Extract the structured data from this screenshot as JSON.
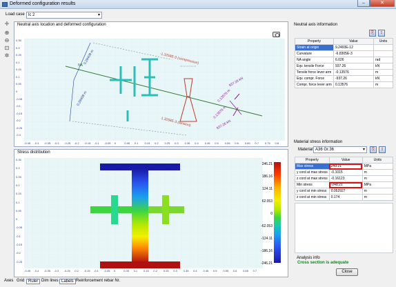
{
  "window": {
    "title": "Deformed configuration results",
    "minimize": "–",
    "close": "✕"
  },
  "load_case": {
    "label": "Load case",
    "value": "lc 2"
  },
  "toolbar": {
    "icons": [
      "pan-icon",
      "zoom-in-icon",
      "zoom-out-icon",
      "zoom-window-icon",
      "zoom-extents-icon"
    ],
    "glyphs": [
      "✛",
      "⊕",
      "⊖",
      "⊡",
      "✲"
    ]
  },
  "neutral_axis_panel": {
    "title": "Neutral axis location and deformed configuration",
    "y_ticks": [
      "0.35",
      "0.3",
      "0.25",
      "0.2",
      "0.15",
      "0.1",
      "0.05",
      "0",
      "-0.05",
      "-0.1",
      "-0.15",
      "-0.2",
      "-0.25",
      "-0.3"
    ],
    "x_ticks": [
      "-0.45",
      "-0.4",
      "-0.35",
      "-0.3",
      "-0.25",
      "-0.2",
      "-0.15",
      "-0.1",
      "-0.05",
      "0",
      "0.05",
      "0.1",
      "0.15",
      "0.2",
      "0.25",
      "0.3",
      "0.35",
      "0.4",
      "0.45",
      "0.5",
      "0.55",
      "0.6",
      "0.65",
      "0.7",
      "0.75",
      "0.8"
    ],
    "annotations": {
      "dim_top": "0.29409 m",
      "dim_bottom": "0.29409 m",
      "na": "NA",
      "strain_comp": "-1.3258E-3 (compression)",
      "strain_tens": "1.3258E-3 (tension)",
      "force_comp": "937.26 kN",
      "force_tens": "937.26 kN",
      "arm_top": "0.13576 m",
      "arm_bottom": "0.13576 m"
    }
  },
  "stress_panel": {
    "title": "Stress distribution",
    "y_ticks": [
      "0.35",
      "0.3",
      "0.25",
      "0.2",
      "0.15",
      "0.1",
      "0.05",
      "0",
      "-0.05",
      "-0.1",
      "-0.15",
      "-0.2",
      "-0.25"
    ],
    "x_ticks": [
      "-0.45",
      "-0.4",
      "-0.35",
      "-0.3",
      "-0.25",
      "-0.2",
      "-0.15",
      "-0.1",
      "-0.05",
      "0",
      "0.05",
      "0.1",
      "0.15",
      "0.2",
      "0.25",
      "0.3",
      "0.35",
      "0.4",
      "0.45",
      "0.5",
      "0.55",
      "0.6",
      "0.65",
      "0.7"
    ],
    "colorbar_labels": [
      "246.21",
      "186.16",
      "124.11",
      "62.053",
      "0",
      "-62.053",
      "-124.11",
      "-186.16",
      "-246.21"
    ]
  },
  "na_info": {
    "title": "Neutral axis information",
    "headers": [
      "Property",
      "Value",
      "Units"
    ],
    "rows": [
      {
        "property": "Strain at origin",
        "value": "9.2493E-12",
        "units": ""
      },
      {
        "property": "Curvature",
        "value": "-6.8305E-3",
        "units": ""
      },
      {
        "property": "NA angle",
        "value": "6.026",
        "units": "rad"
      },
      {
        "property": "Eqv. tensile Force",
        "value": "937.26",
        "units": "kN"
      },
      {
        "property": "Tensile force lever arm",
        "value": "-0.13576",
        "units": "m"
      },
      {
        "property": "Eqv. compr. Force",
        "value": "-937.26",
        "units": "kN"
      },
      {
        "property": "Compr. force lever arm",
        "value": "0.13576",
        "units": "m"
      }
    ]
  },
  "material_info": {
    "title": "Material stress information",
    "material_label": "Material",
    "material_value": "A36 Gr.36",
    "headers": [
      "Property",
      "Value",
      "Units"
    ],
    "rows": [
      {
        "property": "Max stress",
        "value": "249.21",
        "units": "MPa"
      },
      {
        "property": "y cord at max stress",
        "value": "-0.1015",
        "units": "m"
      },
      {
        "property": "z cord at max stress",
        "value": "-0.16123",
        "units": "m"
      },
      {
        "property": "Min stress",
        "value": "-248.21",
        "units": "MPa"
      },
      {
        "property": "y cord at min stress",
        "value": "0.052927",
        "units": "m"
      },
      {
        "property": "z cord at min stress",
        "value": "0.174",
        "units": "m"
      }
    ]
  },
  "analysis": {
    "title": "Analysis info",
    "status": "Cross section is adequate",
    "close": "Close"
  },
  "footer": [
    "Axes",
    "Grid",
    "Ruler",
    "Dim lines",
    "Labels",
    "Reinforcement rebar Nr."
  ],
  "colors": {
    "section": "#2bbdb6",
    "na_line": "#2f7a2f",
    "compression": "#c0392b",
    "force": "#8e1fa0",
    "dim": "#1f3fa0"
  }
}
